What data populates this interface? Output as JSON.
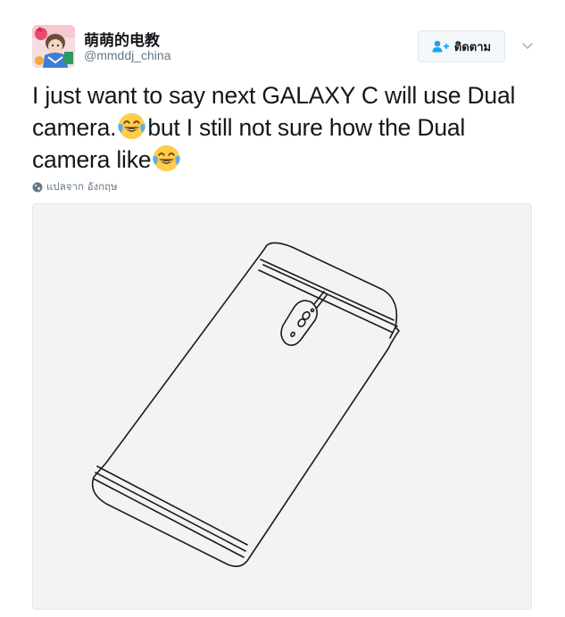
{
  "author": {
    "display_name": "萌萌的电教",
    "username": "@mmddj_china",
    "avatar_icon": "avatar-illustration"
  },
  "follow_button": {
    "label": "ติดตาม",
    "icon": "add-user-icon",
    "accent": "#1da1f2"
  },
  "menu": {
    "icon": "chevron-down-icon"
  },
  "tweet": {
    "line1": "I just want to say next GALAXY C will use Dual",
    "line2_part1": "camera.",
    "line2_part2": "but I still not sure how the Dual",
    "line3_part1": "camera like",
    "emoji": "face-with-tears-of-joy"
  },
  "translate": {
    "label": "แปลจาก อังกฤษ",
    "icon": "globe-icon"
  },
  "media": {
    "description_icon": "phone-sketch-image"
  },
  "colors": {
    "text": "#14171a",
    "secondary": "#657786",
    "border": "#e1e8ed",
    "media_bg": "#f3f3f3"
  }
}
